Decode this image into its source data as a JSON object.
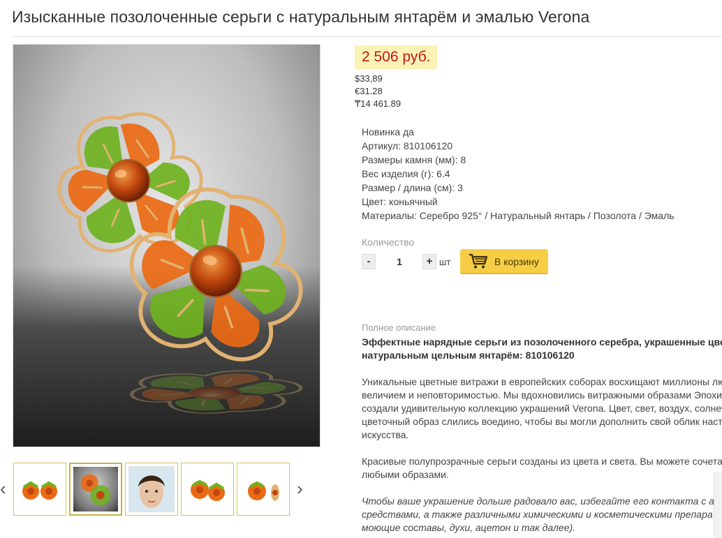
{
  "product": {
    "title": "Изысканные позолоченные серьги с натуральным янтарём и эмалью Verona",
    "price": "2 506 руб.",
    "currencies": [
      "$33,89",
      "€31.28",
      "₸14 461.89"
    ]
  },
  "properties": [
    {
      "label": "Новинка",
      "value": "да"
    },
    {
      "label": "Артикул:",
      "value": "810106120"
    },
    {
      "label": "Размеры камня (мм):",
      "value": "8"
    },
    {
      "label": "Вес изделия (г):",
      "value": "6.4"
    },
    {
      "label": "Размер / длина (см):",
      "value": "3"
    },
    {
      "label": "Цвет:",
      "value": "коньячный"
    },
    {
      "label": "Материалы:",
      "value": "Серебро 925° / Натуральный янтарь / Позолота / Эмаль"
    }
  ],
  "quantity": {
    "label": "Количество",
    "minus": "-",
    "value": "1",
    "plus": "+",
    "unit": "шт"
  },
  "cart": {
    "label": "В корзину",
    "icon": "shopping-cart-icon"
  },
  "gallery": {
    "prev_icon": "chevron-left-icon",
    "next_icon": "chevron-right-icon",
    "thumbs": [
      {
        "kind": "earrings-pair"
      },
      {
        "kind": "earrings-closeup",
        "active": true
      },
      {
        "kind": "model-face"
      },
      {
        "kind": "earrings-pair"
      },
      {
        "kind": "earrings-side"
      }
    ]
  },
  "description": {
    "label": "Полное описание",
    "heading": "Эффектные нарядные серьги из позолоченного серебра, украшенные цве",
    "heading2": "натуральным цельным янтарём: 810106120",
    "p1": [
      "Уникальные цветные витражи в европейских соборах восхищают миллионы лю",
      "величием и неповторимостью. Мы вдохновились витражными образами Эпохи",
      "создали удивительную коллекцию украшений Verona. Цвет, свет, воздух, солнеч",
      "цветочный образ слились воедино, чтобы вы могли дополнить свой облик наст",
      "искусства."
    ],
    "p2": [
      "Красивые полупрозрачные серьги созданы из цвета и света. Вы можете сочета",
      "любыми образами."
    ],
    "p3": [
      "Чтобы ваше украшение дольше радовало вас, избегайте его контакта с а",
      "средствами, а также различными химическими и косметическими препара",
      "моющие составы, духи, ацетон и так далее)."
    ]
  },
  "colors": {
    "price_bg": "#fbf3b5",
    "price_text": "#c4151c",
    "cart_button": "#f7cd45",
    "thumb_border": "#d9c25a",
    "amber": "#c0470e",
    "enamel_orange": "#ea6a14",
    "enamel_green": "#6fb21f",
    "gold": "#e2b271"
  }
}
